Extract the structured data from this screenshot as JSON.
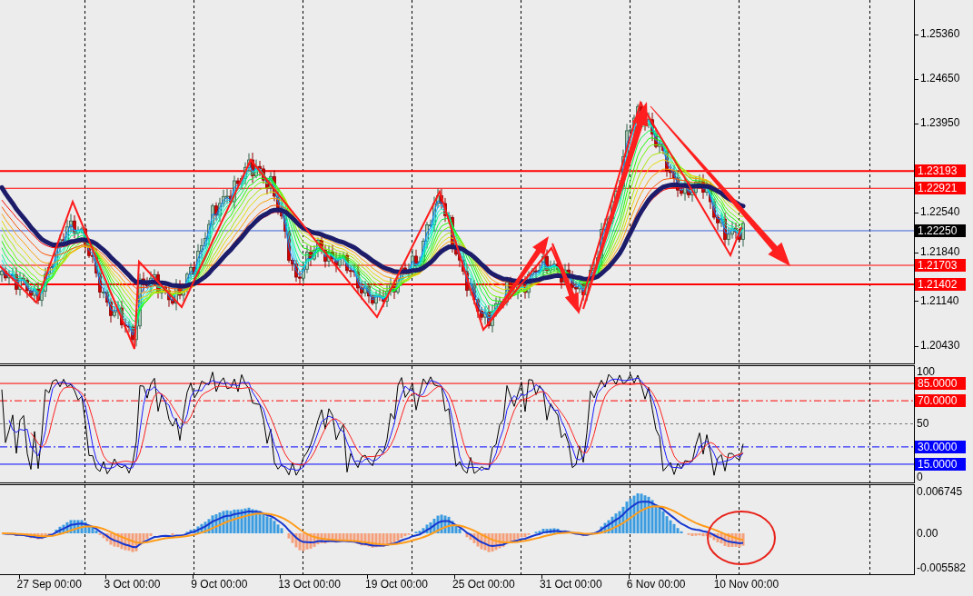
{
  "price_panel": {
    "axis_labels": [
      "1.25360",
      "1.24650",
      "1.23950",
      "1.22540",
      "1.21840",
      "1.21140",
      "1.20430"
    ],
    "levels": [
      {
        "label": "1.23193",
        "kind": "major",
        "color": "#ff0000"
      },
      {
        "label": "1.22921",
        "kind": "minor",
        "color": "#ff0000"
      },
      {
        "label": "1.22250",
        "kind": "current",
        "color": "#000000"
      },
      {
        "label": "1.21703",
        "kind": "minor",
        "color": "#ff0000"
      },
      {
        "label": "1.21402",
        "kind": "major",
        "color": "#ff0000"
      }
    ]
  },
  "oscillator_panel": {
    "axis_labels": [
      {
        "label": "100",
        "kind": "plain"
      },
      {
        "label": "50",
        "kind": "dashed"
      },
      {
        "label": "0",
        "kind": "plain"
      }
    ],
    "levels": [
      {
        "label": "85.0000",
        "kind": "solid",
        "color": "#ff0000"
      },
      {
        "label": "70.0000",
        "kind": "dashdot",
        "color": "#ff0000"
      },
      {
        "label": "30.0000",
        "kind": "dashdot",
        "color": "#0000ff"
      },
      {
        "label": "15.0000",
        "kind": "solid",
        "color": "#0000ff"
      }
    ]
  },
  "macd_panel": {
    "axis_labels": [
      "0.006745",
      "0.00",
      "-0.005582"
    ]
  },
  "time_axis": {
    "labels": [
      "27 Sep 00:00",
      "3 Oct 00:00",
      "9 Oct 00:00",
      "13 Oct 00:00",
      "19 Oct 00:00",
      "25 Oct 00:00",
      "31 Oct 00:00",
      "6 Nov 00:00",
      "10 Nov 00:00"
    ]
  }
}
